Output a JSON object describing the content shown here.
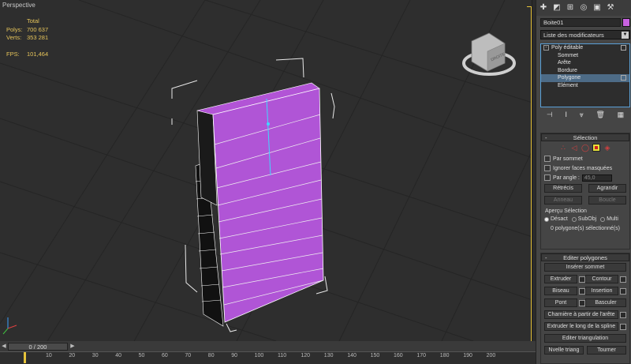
{
  "viewport": {
    "label": "Perspective",
    "stats": {
      "header": "Total",
      "polys_label": "Polys:",
      "polys_value": "700 637",
      "verts_label": "Verts:",
      "verts_value": "353 281",
      "fps_label": "FPS:",
      "fps_value": "101,464"
    },
    "viewcube_text": "DROITE"
  },
  "timeline": {
    "slider_label": "0 / 200",
    "ticks": [
      "10",
      "20",
      "30",
      "40",
      "50",
      "60",
      "70",
      "80",
      "90",
      "100",
      "110",
      "120",
      "130",
      "140",
      "150",
      "160",
      "170",
      "180",
      "190",
      "200"
    ]
  },
  "panel": {
    "tabs": [
      "create-icon",
      "modify-icon",
      "hierarchy-icon",
      "motion-icon",
      "display-icon",
      "utilities-icon"
    ],
    "object_name": "Boite01",
    "object_color": "#c862e0",
    "modifier_list": "Liste des modificateurs",
    "stack": {
      "root": "Poly éditable",
      "items": [
        "Sommet",
        "Arête",
        "Bordure",
        "Polygone",
        "Elément"
      ],
      "selected": "Polygone"
    },
    "selection": {
      "title": "Sélection",
      "by_vertex": "Par sommet",
      "ignore_backfacing": "Ignorer faces masquées",
      "by_angle": "Par angle :",
      "angle_value": "45,0",
      "shrink": "Rétrécis",
      "grow": "Agrandir",
      "ring": "Anneau",
      "loop": "Boucle",
      "preview_title": "Aperçu Sélection",
      "preview_off": "Désact",
      "preview_subobj": "SubObj",
      "preview_multi": "Multi",
      "status": "0 polygone(s) sélectionné(s)"
    },
    "edit_polygons": {
      "title": "Editer polygones",
      "insert_vertex": "Insérer sommet",
      "extrude": "Extruder",
      "outline": "Contour",
      "bevel": "Biseau",
      "inset": "Insertion",
      "bridge": "Pont",
      "flip": "Basculer",
      "hinge": "Charnière à partir de l'arête",
      "extrude_spline": "Extruder le long de la spline",
      "edit_triangulation": "Editer triangulation",
      "retriangulate": "Nvelle triang",
      "turn": "Tourner"
    }
  }
}
